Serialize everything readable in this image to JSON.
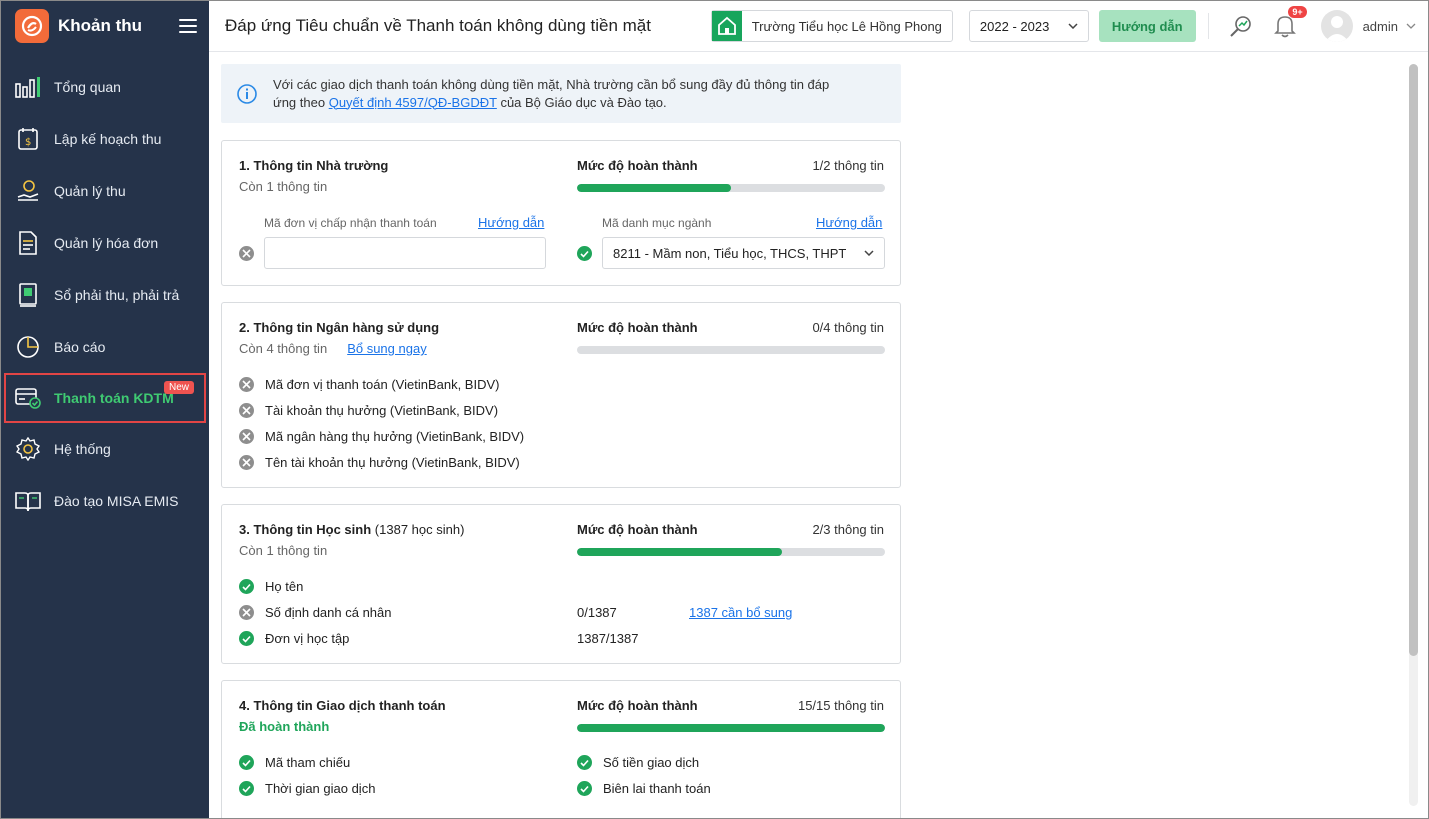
{
  "app": {
    "title": "Khoản thu"
  },
  "sidebar": {
    "items": [
      {
        "label": "Tổng quan",
        "icon": "chart-bar-icon"
      },
      {
        "label": "Lập kế hoạch thu",
        "icon": "calendar-money-icon"
      },
      {
        "label": "Quản lý thu",
        "icon": "hand-coin-icon"
      },
      {
        "label": "Quản lý hóa đơn",
        "icon": "invoice-icon"
      },
      {
        "label": "Sổ phải thu, phải trả",
        "icon": "ledger-icon"
      },
      {
        "label": "Báo cáo",
        "icon": "pie-chart-icon"
      },
      {
        "label": "Thanh toán KDTM",
        "icon": "card-check-icon",
        "badge": "New",
        "active": true
      },
      {
        "label": "Hệ thống",
        "icon": "gear-icon"
      },
      {
        "label": "Đào tạo MISA EMIS",
        "icon": "book-icon"
      }
    ]
  },
  "header": {
    "page_title": "Đáp ứng Tiêu chuẩn về Thanh toán không dùng tiền mặt",
    "school": "Trường Tiểu học Lê Hồng Phong",
    "year": "2022 - 2023",
    "guide_button": "Hướng dẫn",
    "notification_count": "9+",
    "user_name": "admin"
  },
  "info": {
    "text_before": "Với các giao dịch thanh toán không dùng tiền mặt, Nhà trường cần bổ sung đầy đủ thông tin đáp ứng theo ",
    "link": "Quyết định 4597/QĐ-BGDĐT",
    "text_after": " của Bộ Giáo dục và Đào tạo."
  },
  "completion_label": "Mức độ hoàn thành",
  "sections": [
    {
      "title": "1. Thông tin Nhà trường",
      "remaining": "Còn 1 thông tin",
      "count": "1/2 thông tin",
      "progress": 0.5,
      "fields": [
        {
          "label": "Mã đơn vị chấp nhận thanh toán",
          "guide": "Hướng dẫn",
          "value": "",
          "status": "missing"
        },
        {
          "label": "Mã danh mục ngành",
          "guide": "Hướng dẫn",
          "value": "8211 - Mầm non, Tiểu học, THCS, THPT",
          "status": "done"
        }
      ]
    },
    {
      "title": "2. Thông tin Ngân hàng sử dụng",
      "remaining": "Còn 4 thông tin",
      "add_link": "Bổ sung ngay",
      "count": "0/4 thông tin",
      "progress": 0,
      "items": [
        {
          "label": "Mã đơn vị thanh toán (VietinBank, BIDV)",
          "status": "missing"
        },
        {
          "label": "Tài khoản thụ hưởng (VietinBank, BIDV)",
          "status": "missing"
        },
        {
          "label": "Mã ngân hàng thụ hưởng (VietinBank, BIDV)",
          "status": "missing"
        },
        {
          "label": "Tên tài khoản thụ hưởng (VietinBank, BIDV)",
          "status": "missing"
        }
      ]
    },
    {
      "title": "3. Thông tin Học sinh",
      "title_sub": "(1387 học sinh)",
      "remaining": "Còn 1 thông tin",
      "count": "2/3 thông tin",
      "progress": 0.667,
      "items": [
        {
          "label": "Họ tên",
          "status": "done",
          "value": "",
          "link": ""
        },
        {
          "label": "Số định danh cá nhân",
          "status": "missing",
          "value": "0/1387",
          "link": "1387 cần bổ sung"
        },
        {
          "label": "Đơn vị học tập",
          "status": "done",
          "value": "1387/1387",
          "link": ""
        }
      ]
    },
    {
      "title": "4. Thông tin Giao dịch thanh toán",
      "remaining": "Đã hoàn thành",
      "count": "15/15 thông tin",
      "progress": 1,
      "items_left": [
        {
          "label": "Mã tham chiếu",
          "status": "done"
        },
        {
          "label": "Thời gian giao dịch",
          "status": "done"
        }
      ],
      "items_right": [
        {
          "label": "Số tiền giao dịch",
          "status": "done"
        },
        {
          "label": "Biên lai thanh toán",
          "status": "done"
        }
      ]
    }
  ],
  "colors": {
    "sidebar_bg": "#25334a",
    "accent_green": "#1fa55a",
    "brand_orange": "#f26b3a",
    "link_blue": "#1a73e8"
  }
}
